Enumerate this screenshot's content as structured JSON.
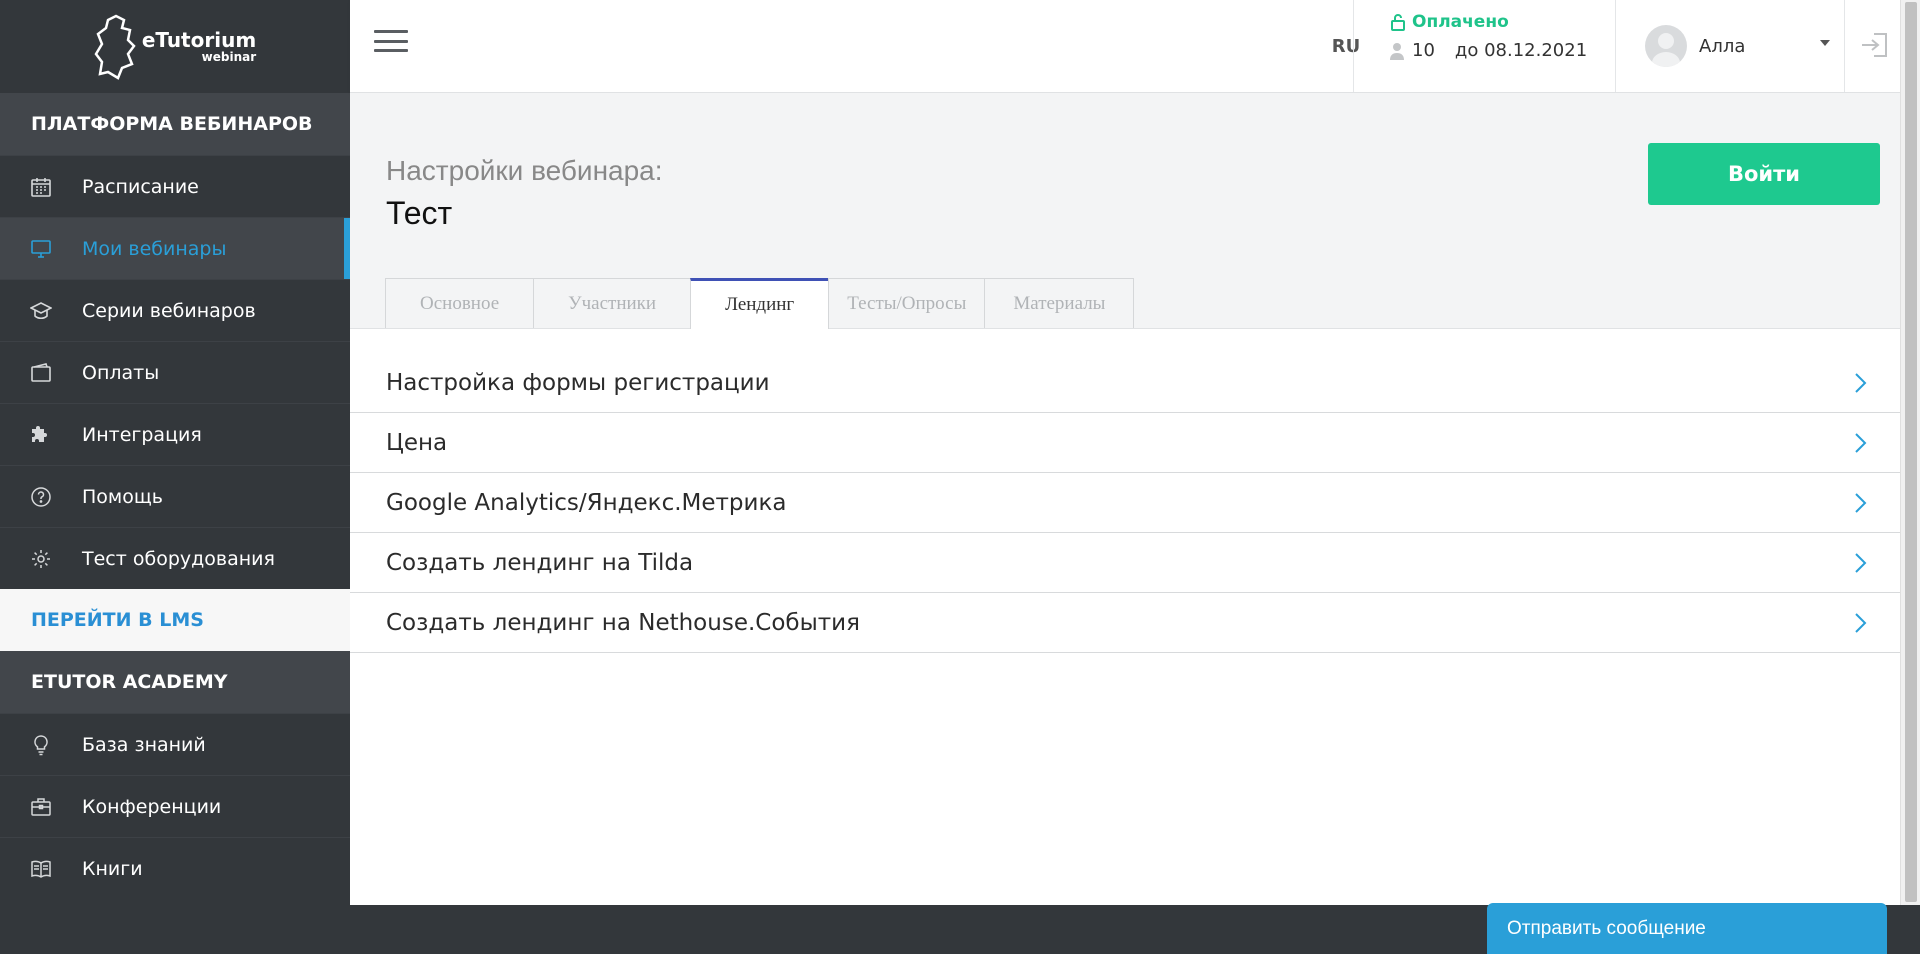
{
  "brand": {
    "logo_main": "eTutorium",
    "logo_sub": "webinar"
  },
  "sidebar": {
    "section1": "ПЛАТФОРМА ВЕБИНАРОВ",
    "items": [
      {
        "label": "Расписание",
        "icon": "calendar-icon"
      },
      {
        "label": "Мои вебинары",
        "icon": "monitor-icon",
        "active": true
      },
      {
        "label": "Серии вебинаров",
        "icon": "graduation-cap-icon"
      },
      {
        "label": "Оплаты",
        "icon": "wallet-icon"
      },
      {
        "label": "Интеграция",
        "icon": "puzzle-icon"
      },
      {
        "label": "Помощь",
        "icon": "help-icon"
      },
      {
        "label": "Тест оборудования",
        "icon": "gear-icon"
      }
    ],
    "lms_link": "ПЕРЕЙТИ В LMS",
    "section2": "ETUTOR ACADEMY",
    "academy": [
      {
        "label": "База знаний",
        "icon": "lightbulb-icon"
      },
      {
        "label": "Конференции",
        "icon": "briefcase-icon"
      },
      {
        "label": "Книги",
        "icon": "book-icon"
      }
    ]
  },
  "topbar": {
    "lang": "RU",
    "plan_status": "Оплачено",
    "seats": "10",
    "valid_until": "до 08.12.2021",
    "user_name": "Алла"
  },
  "page": {
    "subtitle": "Настройки вебинара:",
    "title": "Тест",
    "enter_button": "Войти",
    "tabs": [
      "Основное",
      "Участники",
      "Лендинг",
      "Тесты/Опросы",
      "Материалы"
    ],
    "active_tab": 2,
    "settings": [
      "Настройка формы регистрации",
      "Цена",
      "Google Analytics/Яндекс.Метрика",
      "Создать лендинг на Tilda",
      "Создать лендинг на Nethouse.События"
    ]
  },
  "chat": {
    "label": "Отправить сообщение"
  },
  "colors": {
    "accent_green": "#1ec98f",
    "accent_blue": "#2a9fd8",
    "sidebar_bg": "#33373b",
    "active_tab": "#3f51b5"
  }
}
